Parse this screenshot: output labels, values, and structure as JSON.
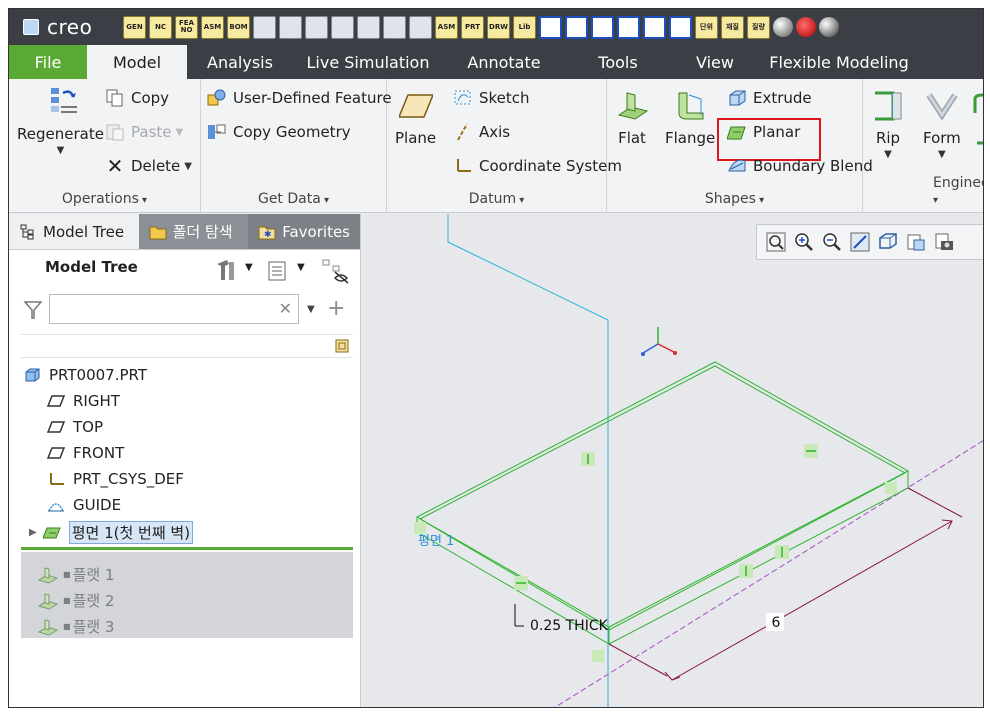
{
  "app": {
    "logo_text": "creo"
  },
  "quick_access": [
    {
      "icon": "gen-icon",
      "text": "GEN"
    },
    {
      "icon": "nc-icon",
      "text": "NC"
    },
    {
      "icon": "fea-icon",
      "text": "FEA NO"
    },
    {
      "icon": "asm-icon",
      "text": "ASM"
    },
    {
      "icon": "bom-icon",
      "text": "BOM"
    },
    {
      "icon": "settings-icon",
      "text": ""
    },
    {
      "icon": "new-file-icon",
      "text": ""
    },
    {
      "icon": "save-icon",
      "text": ""
    },
    {
      "icon": "save-copy-icon",
      "text": ""
    },
    {
      "icon": "edit-doc-icon",
      "text": ""
    },
    {
      "icon": "edit-doc2-icon",
      "text": ""
    },
    {
      "icon": "open-folder-icon",
      "text": ""
    },
    {
      "icon": "asm-folder-icon",
      "text": "ASM"
    },
    {
      "icon": "prt-folder-icon",
      "text": "PRT"
    },
    {
      "icon": "drw-folder-icon",
      "text": "DRW"
    },
    {
      "icon": "lib-folder-icon",
      "text": "Lib"
    },
    {
      "icon": "window-icon",
      "text": ""
    },
    {
      "icon": "window2-icon",
      "text": ""
    },
    {
      "icon": "window3-icon",
      "text": ""
    },
    {
      "icon": "window4-icon",
      "text": ""
    },
    {
      "icon": "window5-icon",
      "text": ""
    },
    {
      "icon": "window6-icon",
      "text": ""
    },
    {
      "icon": "unit-icon",
      "text": "단위"
    },
    {
      "icon": "material-icon",
      "text": "재질"
    },
    {
      "icon": "mass-icon",
      "text": "질량"
    },
    {
      "icon": "sphere-icon",
      "text": ""
    },
    {
      "icon": "red-dot-icon",
      "text": ""
    },
    {
      "icon": "gray-sphere-icon",
      "text": ""
    }
  ],
  "tabs": [
    "File",
    "Model",
    "Analysis",
    "Live Simulation",
    "Annotate",
    "Tools",
    "View",
    "Flexible Modeling"
  ],
  "ribbon": {
    "operations": {
      "regenerate": "Regenerate",
      "copy": "Copy",
      "paste": "Paste",
      "delete": "Delete",
      "label": "Operations"
    },
    "get_data": {
      "user_defined_feature": "User-Defined Feature",
      "copy_geometry": "Copy Geometry",
      "label": "Get Data"
    },
    "datum": {
      "plane": "Plane",
      "sketch": "Sketch",
      "axis": "Axis",
      "coordinate_system": "Coordinate System",
      "label": "Datum"
    },
    "shapes": {
      "flat": "Flat",
      "flange": "Flange",
      "extrude": "Extrude",
      "planar": "Planar",
      "boundary_blend": "Boundary Blend",
      "label": "Shapes"
    },
    "engineering": {
      "rip": "Rip",
      "form": "Form",
      "label": "Engineering"
    }
  },
  "panel": {
    "tabs": [
      "Model Tree",
      "폴더 탐색",
      "Favorites"
    ],
    "title": "Model Tree",
    "search_placeholder": "",
    "items": [
      {
        "label": "PRT0007.PRT",
        "icon": "part-icon"
      },
      {
        "label": "RIGHT",
        "icon": "datum-plane-icon"
      },
      {
        "label": "TOP",
        "icon": "datum-plane-icon"
      },
      {
        "label": "FRONT",
        "icon": "datum-plane-icon"
      },
      {
        "label": "PRT_CSYS_DEF",
        "icon": "csys-icon"
      },
      {
        "label": "GUIDE",
        "icon": "guide-icon"
      },
      {
        "label": "평면 1(첫 번째 벽)",
        "icon": "planar-wall-icon"
      }
    ],
    "suppressed": [
      "플랫 1",
      "플랫 2",
      "플랫 3"
    ]
  },
  "viewport": {
    "surface_label": "평면 1",
    "thickness_label": "0.25 THICK",
    "dim_value": "6"
  },
  "colors": {
    "accent_green": "#5ba935",
    "highlight_red": "#e0161d",
    "model_green": "#2db52d",
    "dim_maroon": "#8b1040"
  }
}
